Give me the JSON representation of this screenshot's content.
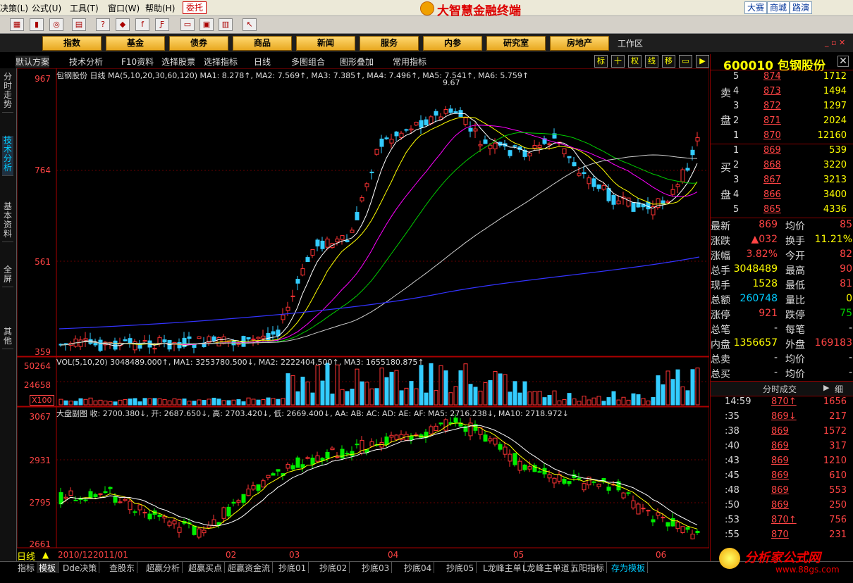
{
  "menu": [
    "决策(L)",
    "公式(U)",
    "工具(T)",
    "窗口(W)",
    "帮助(H)"
  ],
  "entrust_label": "委托",
  "app_title": "大智慧金融终端",
  "top_right": [
    "大赛",
    "商城",
    "路演"
  ],
  "nav_buttons": [
    "指数",
    "基金",
    "债券",
    "商品",
    "新闻",
    "服务",
    "内参",
    "研究室",
    "房地产"
  ],
  "workspace_label": "工作区",
  "subbar": [
    "默认方案",
    "技术分析",
    "F10资料",
    "选择股票",
    "选择指标",
    "日线",
    "多图组合",
    "图形叠加",
    "常用指标"
  ],
  "mini_buttons": [
    "标",
    "十",
    "权",
    "线",
    "移"
  ],
  "left_tabs": [
    "分时走势",
    "技术分析",
    "基本资料",
    "全屏",
    "其他"
  ],
  "main_chart": {
    "info": "包钢股份 日线 MA(5,10,20,30,60,120) MA1: 8.278↑, MA2: 7.569↑, MA3: 7.385↑, MA4: 7.496↑, MA5: 7.541↑, MA6: 5.759↑",
    "high_label": "9.67",
    "y_labels": [
      "967",
      "764",
      "561",
      "359"
    ]
  },
  "vol_chart": {
    "info": "VOL(5,10,20) 3048489.000↑, MA1: 3253780.500↓, MA2: 2222404.500↑, MA3: 1655180.875↑",
    "y_labels": [
      "50264",
      "24658"
    ],
    "unit": "X100"
  },
  "index_chart": {
    "info": "大盘副图 收: 2700.380↓, 开: 2687.650↓, 高: 2703.420↓, 低: 2669.400↓, AA: AB: AC: AD: AE: AF: MA5: 2716.238↓, MA10: 2718.972↓",
    "y_labels": [
      "3067",
      "2931",
      "2795",
      "2661"
    ]
  },
  "x_labels": [
    "2010/12",
    "2011/01",
    "02",
    "03",
    "04",
    "05",
    "06"
  ],
  "period_label": "日线",
  "chart_data": {
    "type": "candlestick",
    "ylim": [
      359,
      967
    ]
  },
  "stock": {
    "code": "600010",
    "name": "包钢股份"
  },
  "asks": [
    {
      "i": "5",
      "p": "874",
      "v": "1712"
    },
    {
      "i": "4",
      "p": "873",
      "v": "1494"
    },
    {
      "i": "3",
      "p": "872",
      "v": "1297"
    },
    {
      "i": "2",
      "p": "871",
      "v": "2024"
    },
    {
      "i": "1",
      "p": "870",
      "v": "12160"
    }
  ],
  "bids": [
    {
      "i": "1",
      "p": "869",
      "v": "539"
    },
    {
      "i": "2",
      "p": "868",
      "v": "3220"
    },
    {
      "i": "3",
      "p": "867",
      "v": "3213"
    },
    {
      "i": "4",
      "p": "866",
      "v": "3400"
    },
    {
      "i": "5",
      "p": "865",
      "v": "4336"
    }
  ],
  "sell_label": "卖盘",
  "buy_label": "买盘",
  "quotes": [
    {
      "l1": "最新",
      "v1": "869",
      "l2": "均价",
      "v2": "85"
    },
    {
      "l1": "涨跌",
      "v1": "▲032",
      "l2": "换手",
      "v2": "11.21%"
    },
    {
      "l1": "涨幅",
      "v1": "3.82%",
      "l2": "今开",
      "v2": "82"
    },
    {
      "l1": "总手",
      "v1": "3048489",
      "l2": "最高",
      "v2": "90"
    },
    {
      "l1": "现手",
      "v1": "1528",
      "l2": "最低",
      "v2": "81"
    },
    {
      "l1": "总额",
      "v1": "260748",
      "l2": "量比",
      "v2": "0"
    },
    {
      "l1": "涨停",
      "v1": "921",
      "l2": "跌停",
      "v2": "75"
    },
    {
      "l1": "总笔",
      "v1": "-",
      "l2": "每笔",
      "v2": "-"
    },
    {
      "l1": "内盘",
      "v1": "1356657",
      "l2": "外盘",
      "v2": "169183"
    },
    {
      "l1": "总卖",
      "v1": "-",
      "l2": "均价",
      "v2": "-"
    },
    {
      "l1": "总买",
      "v1": "-",
      "l2": "均价",
      "v2": "-"
    }
  ],
  "ticks_header": "分时成交",
  "ticks_header2": "细",
  "ticks": [
    {
      "t": "14:59",
      "p": "870↑",
      "v": "1656"
    },
    {
      "t": ":35",
      "p": "869↓",
      "v": "217"
    },
    {
      "t": ":38",
      "p": "869",
      "v": "1572"
    },
    {
      "t": ":40",
      "p": "869",
      "v": "317"
    },
    {
      "t": ":43",
      "p": "869",
      "v": "1210"
    },
    {
      "t": ":45",
      "p": "869",
      "v": "610"
    },
    {
      "t": ":48",
      "p": "869",
      "v": "553"
    },
    {
      "t": ":50",
      "p": "869",
      "v": "250"
    },
    {
      "t": ":53",
      "p": "870↑",
      "v": "756"
    },
    {
      "t": ":55",
      "p": "870",
      "v": "231"
    }
  ],
  "bottom_tabs": [
    "指标",
    "模板",
    "Dde决策",
    "查股东",
    "超赢分析",
    "超赢买点",
    "超赢资金流",
    "抄底01",
    "抄底02",
    "抄底03",
    "抄底04",
    "抄底05",
    "L龙峰主单",
    "L龙峰主单道",
    "五阳指标",
    "存为模板"
  ],
  "watermark": {
    "name": "分析家公式网",
    "url": "www.88gs.com"
  }
}
